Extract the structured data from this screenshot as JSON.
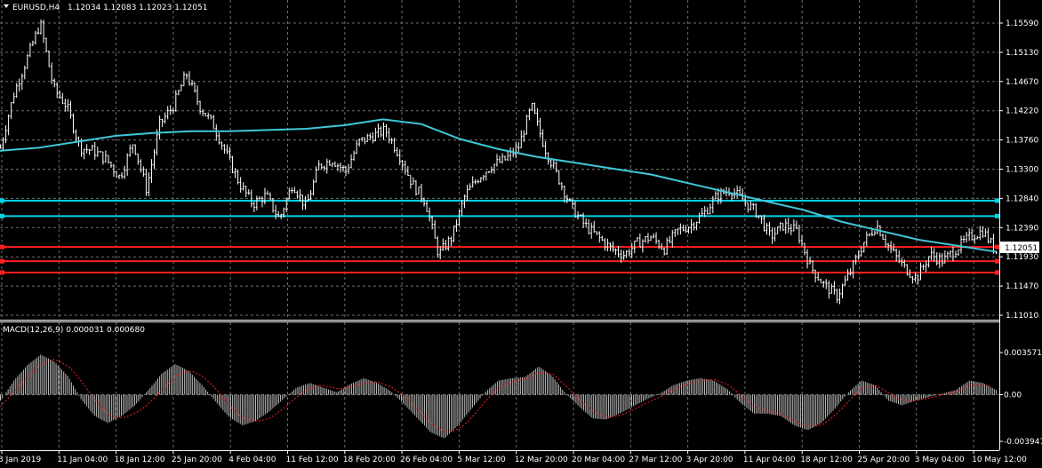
{
  "symbol_header": {
    "label": "EURUSD,H4",
    "ohlc": "1.12034 1.12083 1.12023 1.12051"
  },
  "macd_header": {
    "label": "MACD(12,26,9) 0.000031 0.000680"
  },
  "price_axis": {
    "ticks": [
      "1.15590",
      "1.15130",
      "1.14670",
      "1.14220",
      "1.13760",
      "1.13300",
      "1.12840",
      "1.12390",
      "1.11930",
      "1.11470",
      "1.11010"
    ],
    "current_price": "1.12051"
  },
  "macd_axis": {
    "ticks": [
      "0.003571",
      "0.00",
      "-0.003947"
    ]
  },
  "time_axis": {
    "labels": [
      "3 Jan 2019",
      "11 Jan 04:00",
      "18 Jan 12:00",
      "25 Jan 20:00",
      "4 Feb 04:00",
      "11 Feb 12:00",
      "18 Feb 20:00",
      "26 Feb 04:00",
      "5 Mar 12:00",
      "12 Mar 20:00",
      "20 Mar 04:00",
      "27 Mar 12:00",
      "3 Apr 20:00",
      "11 Apr 04:00",
      "18 Apr 12:00",
      "25 Apr 20:00",
      "3 May 04:00",
      "10 May 12:00"
    ]
  },
  "horizontal_lines": [
    {
      "price": 1.1291,
      "color": "#00d2e6"
    },
    {
      "price": 1.1265,
      "color": "#00d2e6"
    },
    {
      "price": 1.1213,
      "color": "#ff2020"
    },
    {
      "price": 1.1189,
      "color": "#ff2020"
    },
    {
      "price": 1.117,
      "color": "#ff2020"
    }
  ],
  "colors": {
    "background": "#000000",
    "grid": "#6e6e6e",
    "candle": "#ffffff",
    "moving_average": "#40c8d8",
    "macd_histogram": "#c0c0c0",
    "macd_signal": "#ff2020",
    "text": "#ffffff",
    "current_price_bg": "#ffffff",
    "current_price_text": "#000000"
  },
  "chart_data": [
    {
      "type": "line",
      "ylim": [
        1.1098,
        1.159
      ],
      "series": [
        {
          "values": [
            1.138,
            1.147,
            1.153,
            1.159,
            1.148,
            1.145,
            1.138,
            1.1375,
            1.136,
            1.133,
            1.139,
            1.131,
            1.142,
            1.145,
            1.1505,
            1.145,
            1.142,
            1.137,
            1.132,
            1.1285,
            1.13,
            1.126,
            1.132,
            1.128,
            1.135,
            1.136,
            1.134,
            1.139,
            1.14,
            1.141,
            1.137,
            1.132,
            1.129,
            1.12,
            1.123,
            1.13,
            1.133,
            1.135,
            1.136,
            1.138,
            1.145,
            1.138,
            1.133,
            1.128,
            1.125,
            1.123,
            1.121,
            1.12,
            1.122,
            1.123,
            1.121,
            1.124,
            1.125,
            1.127,
            1.13,
            1.131,
            1.129,
            1.127,
            1.123,
            1.125,
            1.124,
            1.118,
            1.115,
            1.113,
            1.117,
            1.122,
            1.125,
            1.121,
            1.118,
            1.116,
            1.12,
            1.119,
            1.121,
            1.123,
            1.124,
            1.1205
          ]
        },
        {
          "values": [
            1.1375,
            1.138,
            1.139,
            1.14,
            1.1405,
            1.1408,
            1.1408,
            1.141,
            1.1412,
            1.1418,
            1.1428,
            1.142,
            1.1395,
            1.1378,
            1.1365,
            1.1355,
            1.1345,
            1.1335,
            1.132,
            1.1305,
            1.129,
            1.1275,
            1.1255,
            1.124,
            1.1225,
            1.1215,
            1.1205
          ]
        }
      ]
    },
    {
      "type": "bar",
      "ylim": [
        -0.003947,
        0.003571
      ],
      "series": [
        {
          "values": [
            -0.0005,
            0.0012,
            0.0025,
            0.0034,
            0.0028,
            0.0016,
            -0.0004,
            -0.0018,
            -0.0024,
            -0.0018,
            -0.0009,
            0.0004,
            0.0018,
            0.0026,
            0.002,
            0.0008,
            -0.0006,
            -0.0019,
            -0.0026,
            -0.0022,
            -0.0014,
            -0.0004,
            0.0006,
            0.001,
            0.0006,
            0.0002,
            0.0009,
            0.0014,
            0.001,
            0.0003,
            -0.0008,
            -0.002,
            -0.0032,
            -0.0037,
            -0.0026,
            -0.0012,
            0.0002,
            0.0012,
            0.0014,
            0.0015,
            0.0024,
            0.0016,
            0.0001,
            -0.001,
            -0.002,
            -0.0021,
            -0.0016,
            -0.001,
            -0.0004,
            0.0001,
            0.0008,
            0.0012,
            0.0014,
            0.0012,
            0.0005,
            -0.0007,
            -0.0016,
            -0.0016,
            -0.0018,
            -0.0026,
            -0.003,
            -0.0024,
            -0.0012,
            0.0002,
            0.0012,
            0.0008,
            -0.0005,
            -0.0009,
            -0.0005,
            -0.0002,
            0.0001,
            0.0004,
            0.0012,
            0.001,
            0.0004
          ]
        },
        {
          "values": [
            -0.001,
            0.0002,
            0.0015,
            0.0026,
            0.003,
            0.0025,
            0.0012,
            -0.0004,
            -0.0017,
            -0.002,
            -0.0016,
            -0.0008,
            0.0004,
            0.0016,
            0.0021,
            0.0016,
            0.0005,
            -0.0009,
            -0.002,
            -0.0023,
            -0.002,
            -0.0012,
            -0.0002,
            0.0006,
            0.0008,
            0.0005,
            0.0006,
            0.001,
            0.0011,
            0.0007,
            -0.0001,
            -0.0012,
            -0.0024,
            -0.0032,
            -0.003,
            -0.002,
            -0.0006,
            0.0006,
            0.0011,
            0.0013,
            0.0019,
            0.0018,
            0.0008,
            -0.0004,
            -0.0014,
            -0.0019,
            -0.0018,
            -0.0013,
            -0.0007,
            -0.0002,
            0.0004,
            0.0009,
            0.0012,
            0.0013,
            0.0009,
            0.0,
            -0.001,
            -0.0014,
            -0.0016,
            -0.0022,
            -0.0027,
            -0.0026,
            -0.0018,
            -0.0006,
            0.0006,
            0.0008,
            0.0002,
            -0.0005,
            -0.0005,
            -0.0003,
            0.0,
            0.0002,
            0.0008,
            0.0009,
            0.0006
          ]
        }
      ]
    }
  ]
}
